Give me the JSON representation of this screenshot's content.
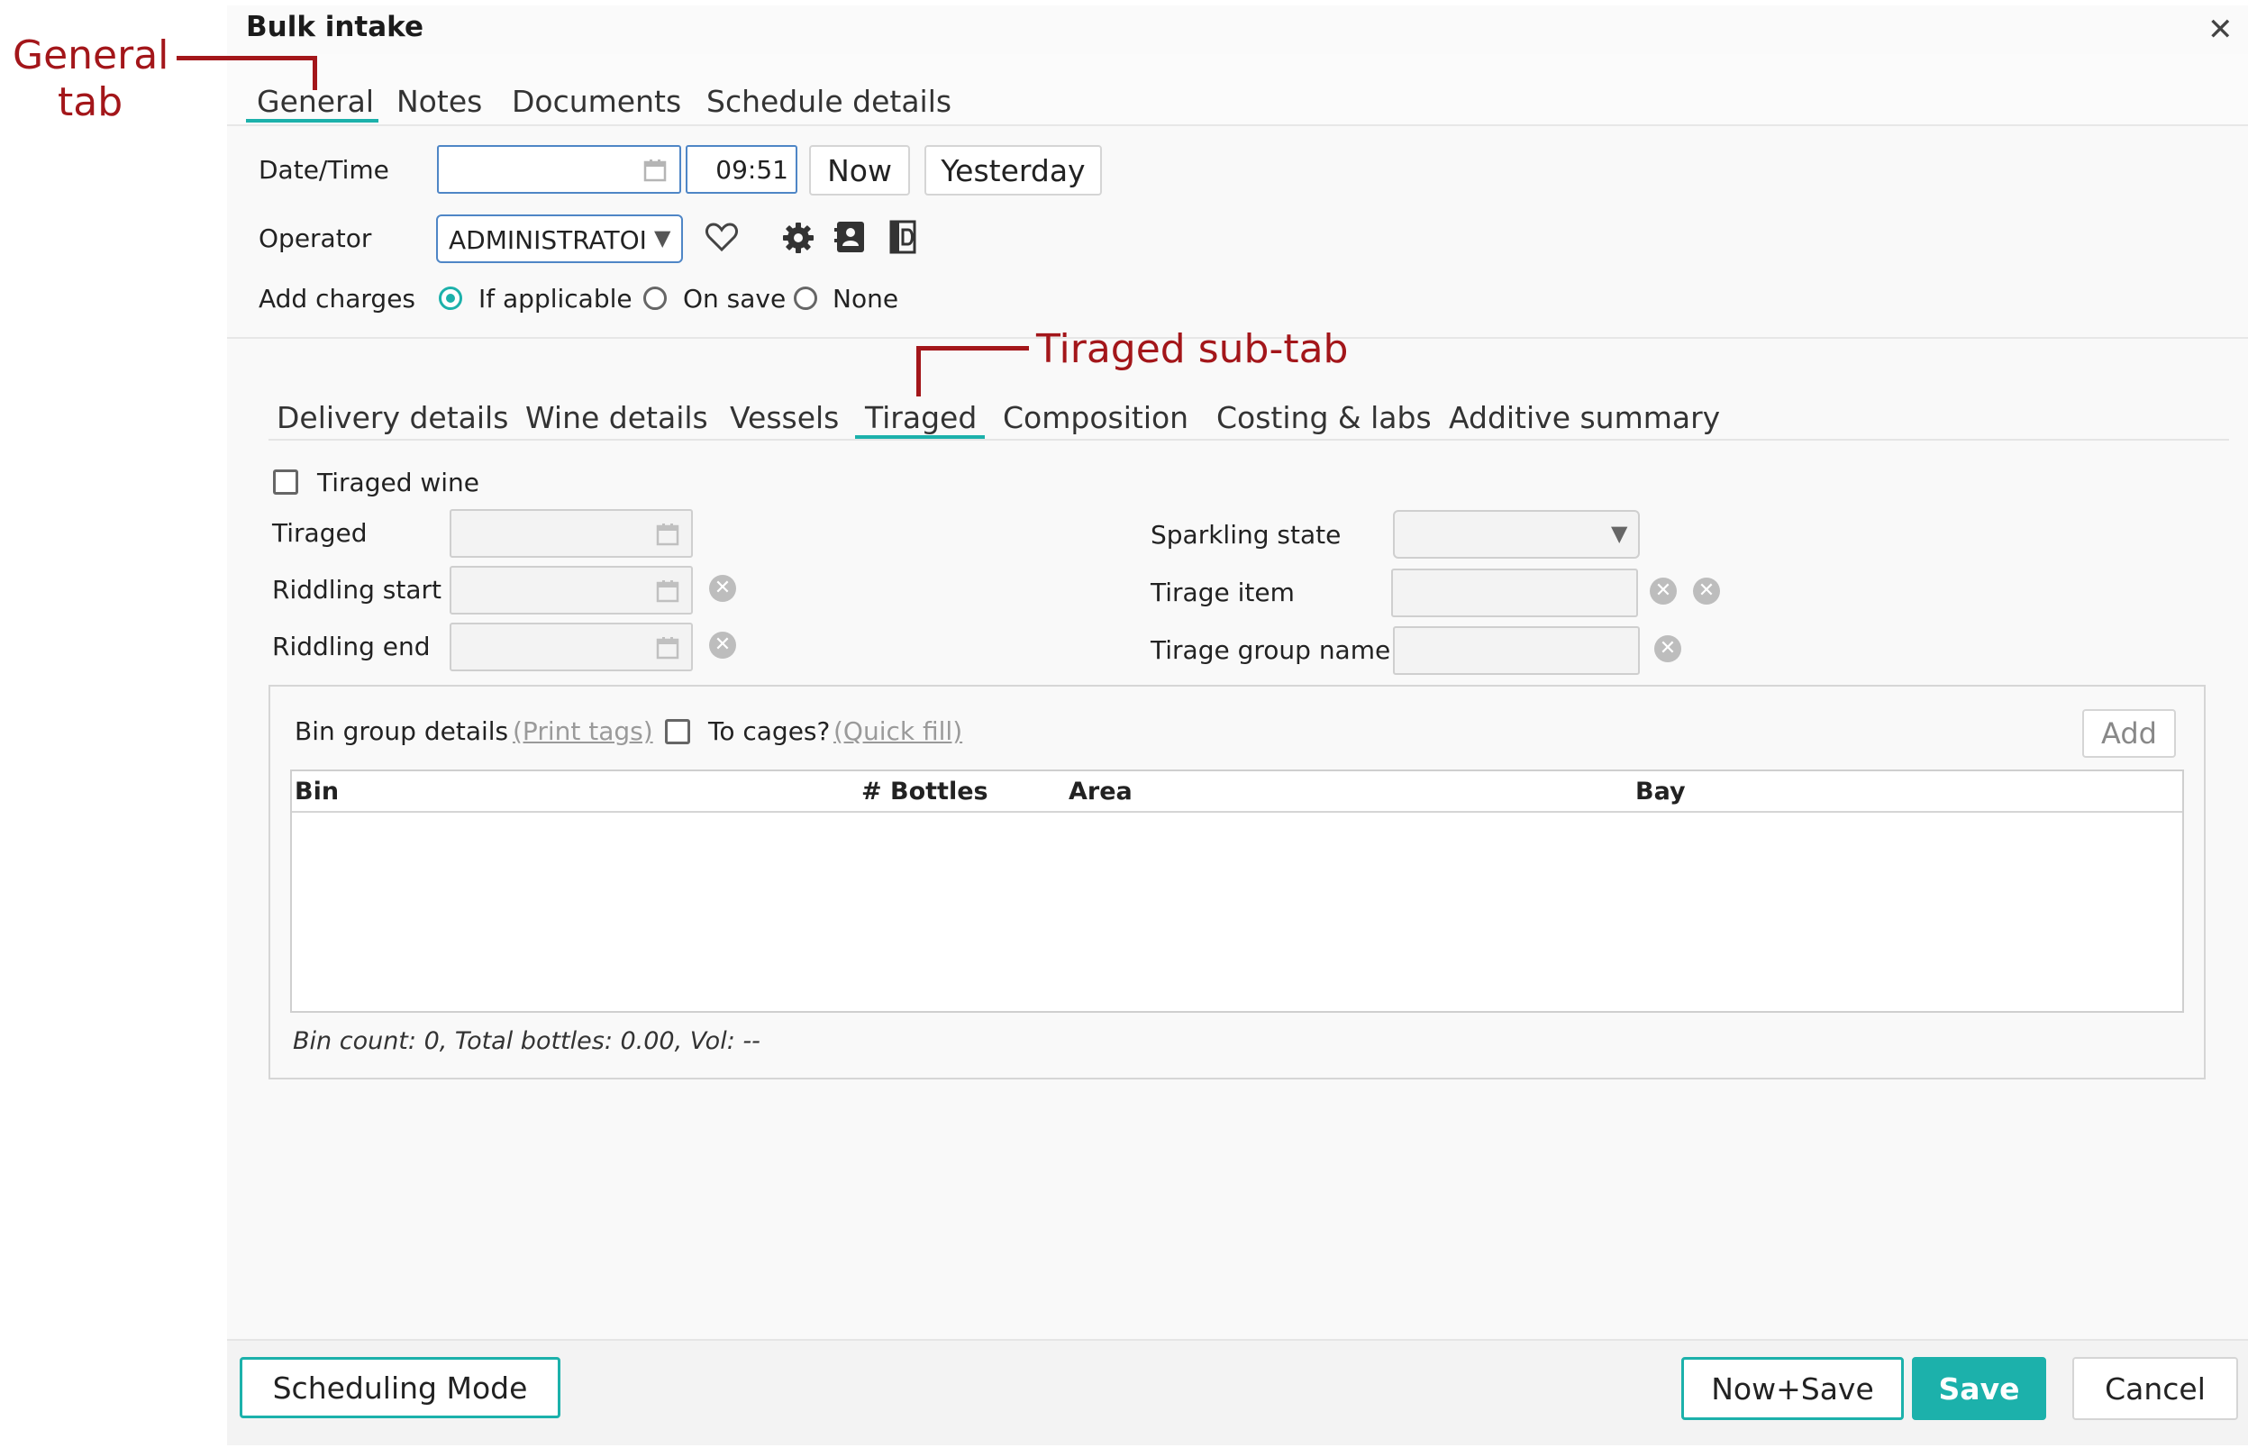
{
  "dialog": {
    "title": "Bulk intake"
  },
  "tabs": [
    "General",
    "Notes",
    "Documents",
    "Schedule details"
  ],
  "general": {
    "datetime_label": "Date/Time",
    "time_value": "09:51",
    "now_label": "Now",
    "yesterday_label": "Yesterday",
    "operator_label": "Operator",
    "operator_value": "ADMINISTRATOI",
    "add_charges_label": "Add charges",
    "charges_options": [
      "If applicable",
      "On save",
      "None"
    ],
    "charges_selected": "If applicable"
  },
  "sub_tabs": [
    "Delivery details",
    "Wine details",
    "Vessels",
    "Tiraged",
    "Composition",
    "Costing & labs",
    "Additive summary"
  ],
  "tiraged": {
    "tiraged_wine_label": "Tiraged wine",
    "tiraged_label": "Tiraged",
    "riddling_start_label": "Riddling start",
    "riddling_end_label": "Riddling end",
    "sparkling_state_label": "Sparkling state",
    "tirage_item_label": "Tirage item",
    "tirage_group_name_label": "Tirage group name"
  },
  "bin_group": {
    "title": "Bin group details",
    "print_tags": "(Print tags)",
    "to_cages_label": "To cages?",
    "quick_fill": "(Quick fill)",
    "add_label": "Add",
    "columns": [
      "Bin",
      "# Bottles",
      "Area",
      "Bay"
    ],
    "summary": "Bin count: 0, Total bottles: 0.00, Vol: --"
  },
  "footer": {
    "scheduling_mode": "Scheduling Mode",
    "now_save": "Now+Save",
    "save": "Save",
    "cancel": "Cancel"
  },
  "annotations": {
    "general_tab_line1": "General",
    "general_tab_line2": "tab",
    "tiraged_subtab": "Tiraged sub-tab"
  },
  "colors": {
    "accent": "#1cb1ab",
    "annotation": "#a3161a",
    "input_border": "#4f86c6"
  }
}
